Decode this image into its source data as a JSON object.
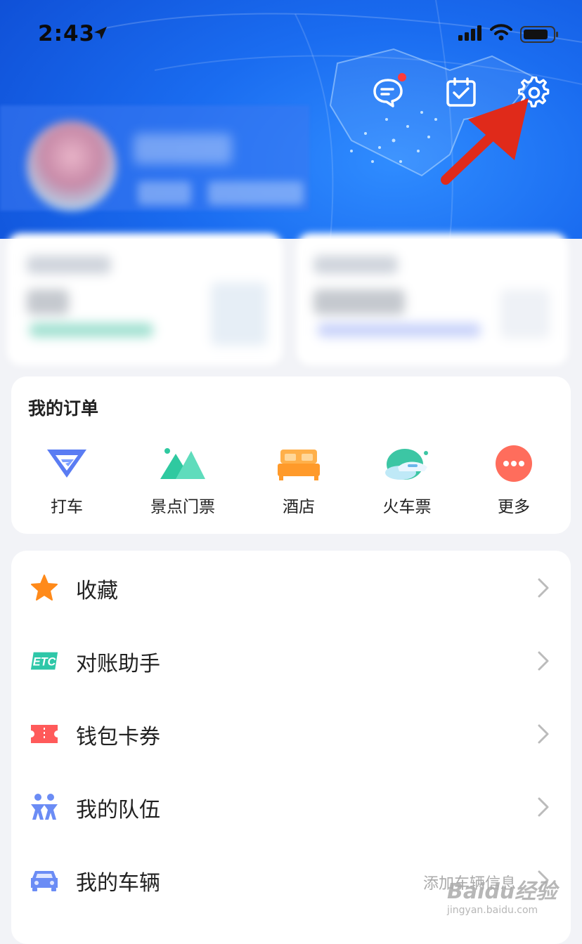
{
  "status_bar": {
    "time": "2:43"
  },
  "orders": {
    "title": "我的订单",
    "items": [
      {
        "label": "打车",
        "icon": "taxi-icon"
      },
      {
        "label": "景点门票",
        "icon": "mountain-icon"
      },
      {
        "label": "酒店",
        "icon": "bed-icon"
      },
      {
        "label": "火车票",
        "icon": "train-icon"
      },
      {
        "label": "更多",
        "icon": "more-icon"
      }
    ]
  },
  "menu": {
    "items": [
      {
        "label": "收藏",
        "icon": "star-icon",
        "hint": ""
      },
      {
        "label": "对账助手",
        "icon": "etc-icon",
        "hint": ""
      },
      {
        "label": "钱包卡券",
        "icon": "ticket-icon",
        "hint": ""
      },
      {
        "label": "我的队伍",
        "icon": "team-icon",
        "hint": ""
      },
      {
        "label": "我的车辆",
        "icon": "car-icon",
        "hint": "添加车辆信息"
      }
    ]
  },
  "watermark": {
    "text": "Baidu经验",
    "sub": "jingyan.baidu.com"
  },
  "colors": {
    "header_blue": "#1a6cf0",
    "accent_red": "#e02a1a",
    "star_orange": "#ff8a1a",
    "etc_teal": "#2ec7a8",
    "ticket_red": "#ff5a5a",
    "icon_blue": "#6b8cf5"
  }
}
